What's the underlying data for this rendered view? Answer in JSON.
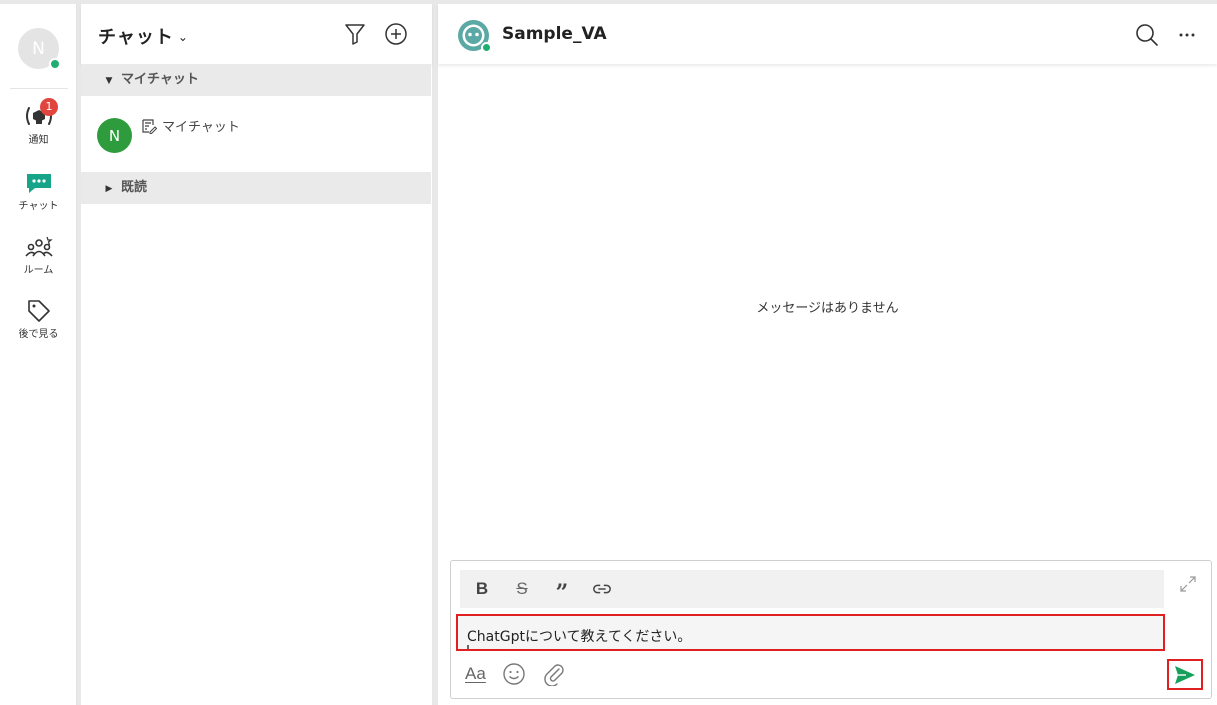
{
  "user": {
    "initial": "N"
  },
  "rail": {
    "items": [
      {
        "label": "通知",
        "icon": "notification-icon",
        "badge": "1"
      },
      {
        "label": "チャット",
        "icon": "chat-icon"
      },
      {
        "label": "ルーム",
        "icon": "room-icon"
      },
      {
        "label": "後で見る",
        "icon": "tag-icon"
      }
    ]
  },
  "chat_list": {
    "title": "チャット",
    "sections": [
      {
        "label": "マイチャット",
        "expanded": true
      },
      {
        "label": "既読",
        "expanded": false
      }
    ],
    "items": [
      {
        "avatar_initial": "N",
        "name": "マイチャット",
        "avatar_color": "#2e9b3c"
      }
    ]
  },
  "conversation": {
    "name": "Sample_VA",
    "empty_message": "メッセージはありません"
  },
  "composer": {
    "toolbar": {
      "bold": "B",
      "strike": "S",
      "quote": "”"
    },
    "text_value": "ChatGptについて教えてください。",
    "format_label": "Aa"
  },
  "colors": {
    "accent": "#1fae6f",
    "badge": "#e0463e",
    "highlight": "#e02020",
    "send": "#17a05a"
  }
}
